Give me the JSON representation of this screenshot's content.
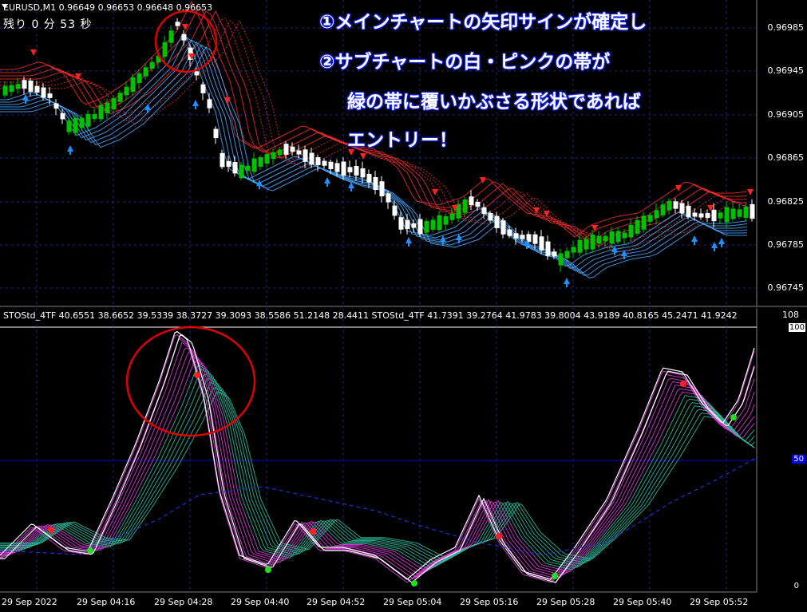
{
  "window": {
    "symbol_label": "EURUSD,M1  0.96649 0.96653 0.96648 0.96653",
    "timer_label": "残り 0 分 53 秒"
  },
  "annotations": {
    "line1": "①メインチャートの矢印サインが確定し",
    "line2": "②サブチャートの白・ピンクの帯が",
    "line3": "緑の帯に覆いかぶさる形状であれば",
    "line4": "エントリー！"
  },
  "main_chart": {
    "price_labels": [
      "0.96985",
      "0.96945",
      "0.96905",
      "0.96865",
      "0.96825",
      "0.96785",
      "0.96745"
    ]
  },
  "sub_chart": {
    "indicator_label": "STOStd_4TF 40.6551 38.6652 39.5339 38.3727 39.3093 38.5586 51.2148 28.4411  STOStd_4TF 41.7391 39.2764 41.9783 39.8004 43.9189 40.8165 45.2471 41.9242",
    "level_labels": [
      "108",
      "100",
      "50",
      "0"
    ]
  },
  "time_axis": {
    "labels": [
      "29 Sep 2022",
      "29 Sep 04:16",
      "29 Sep 04:28",
      "29 Sep 04:40",
      "29 Sep 04:52",
      "29 Sep 05:04",
      "29 Sep 05:16",
      "29 Sep 05:28",
      "29 Sep 05:40",
      "29 Sep 05:52"
    ]
  },
  "colors": {
    "background": "#000000",
    "bull_candle": "#00c000",
    "bear_candle": "#ffffff",
    "sell_arrow": "#ff2020",
    "buy_arrow": "#1e90ff",
    "red_ribbon": "#ff3030",
    "blue_ribbon": "#4aa8ff",
    "pink_band": "#e040e0",
    "green_band": "#30c0a0",
    "circle": "#e00000",
    "level50_line": "#0000e0"
  }
}
